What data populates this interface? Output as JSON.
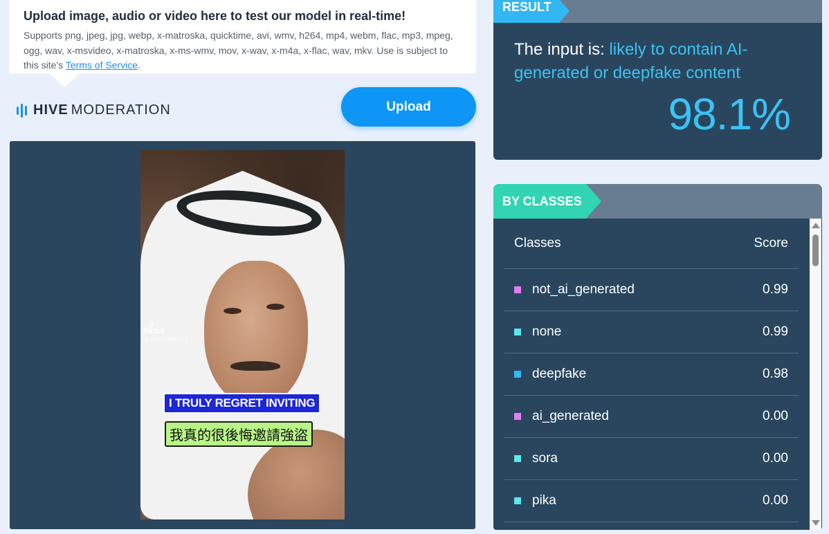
{
  "upload": {
    "title": "Upload image, audio or video here to test our model in real-time!",
    "description": "Supports png, jpeg, jpg, webp, x-matroska, quicktime, avi, wmv, h264, mp4, webm, flac, mp3, mpeg, ogg, wav, x-msvideo, x-matroska, x-ms-wmv, mov, x-wav, x-m4a, x-flac, wav, mkv. Use is subject to this site's ",
    "tos_link": "Terms of Service",
    "tos_suffix": ".",
    "button_label": "Upload"
  },
  "brand": {
    "name_bold": "HIVE",
    "name_light": "MODERATION"
  },
  "media": {
    "tiktok_label": "TikTok",
    "tiktok_user": "@ heart20290312",
    "caption_en": "I TRULY REGRET INVITING",
    "caption_zh": "我真的很後悔邀請強盜"
  },
  "result": {
    "tag": "RESULT",
    "verdict_prefix": "The input is: ",
    "verdict_value": "likely to contain AI-generated or deepfake content",
    "score": "98.1%"
  },
  "classes": {
    "tag": "BY CLASSES",
    "header_class": "Classes",
    "header_score": "Score",
    "rows": [
      {
        "name": "not_ai_generated",
        "score": "0.99",
        "color": "#e47ff0"
      },
      {
        "name": "none",
        "score": "0.99",
        "color": "#5ce6ea"
      },
      {
        "name": "deepfake",
        "score": "0.98",
        "color": "#35b8f0"
      },
      {
        "name": "ai_generated",
        "score": "0.00",
        "color": "#e47ff0"
      },
      {
        "name": "sora",
        "score": "0.00",
        "color": "#5ce6ea"
      },
      {
        "name": "pika",
        "score": "0.00",
        "color": "#5ce6ea"
      }
    ]
  }
}
